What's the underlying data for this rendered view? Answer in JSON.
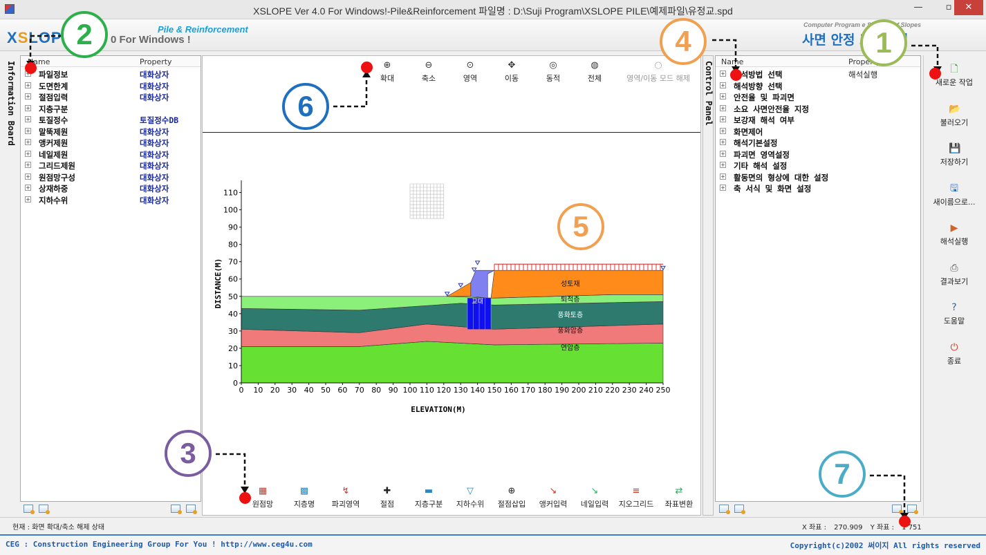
{
  "window": {
    "title": "XSLOPE Ver 4.0 For Windows!-Pile&Reinforcement  파일명 : D:\\Suji Program\\XSLOPE PILE\\예제파일\\유정교.spd",
    "min_label": "—",
    "max_label": "▫",
    "close_label": "✕"
  },
  "header": {
    "logo_x": "X",
    "logo_s": "S",
    "logo_rest": "LOP",
    "logo_sub": "0 For Windows !",
    "tagline": "Pile & Reinforcement",
    "brand_en": "Computer Program      e Stability of Slopes",
    "brand_ko": "사면 안정        프로그램"
  },
  "info_board": {
    "label": "Information Board",
    "col_name": "Name",
    "col_property": "Property",
    "items": [
      {
        "name": "파일정보",
        "property": "대화상자"
      },
      {
        "name": "도면한계",
        "property": "대화상자"
      },
      {
        "name": "절점입력",
        "property": "대화상자"
      },
      {
        "name": "지층구분",
        "property": ""
      },
      {
        "name": "토질정수",
        "property": "토질정수DB"
      },
      {
        "name": "말뚝제원",
        "property": "대화상자"
      },
      {
        "name": "앵커제원",
        "property": "대화상자"
      },
      {
        "name": "네일제원",
        "property": "대화상자"
      },
      {
        "name": "그리드제원",
        "property": "대화상자"
      },
      {
        "name": "원점망구성",
        "property": "대화상자"
      },
      {
        "name": "상재하중",
        "property": "대화상자"
      },
      {
        "name": "지하수위",
        "property": "대화상자"
      }
    ]
  },
  "control_panel": {
    "label": "Control Panel",
    "col_name": "Name",
    "col_property": "Property",
    "items": [
      {
        "name": "해석방법 선택",
        "property": "해석실행"
      },
      {
        "name": "해석방향 선택",
        "property": ""
      },
      {
        "name": "안전율 및 파괴면",
        "property": ""
      },
      {
        "name": "소요 사면안전율 지정",
        "property": ""
      },
      {
        "name": "보강재 해석 여부",
        "property": ""
      },
      {
        "name": "화면제어",
        "property": ""
      },
      {
        "name": "해석기본설정",
        "property": ""
      },
      {
        "name": "파괴면 영역설정",
        "property": ""
      },
      {
        "name": "기타 해석 설정",
        "property": ""
      },
      {
        "name": "활동면의 형상에 대한 설정",
        "property": ""
      },
      {
        "name": "축 서식 및 화면 설정",
        "property": ""
      }
    ]
  },
  "top_toolbar": [
    {
      "label": "확대",
      "icon": "zoom-in-icon",
      "glyph": "⊕"
    },
    {
      "label": "축소",
      "icon": "zoom-out-icon",
      "glyph": "⊖"
    },
    {
      "label": "영역",
      "icon": "zoom-area-icon",
      "glyph": "⊙"
    },
    {
      "label": "이동",
      "icon": "pan-icon",
      "glyph": "✥"
    },
    {
      "label": "동적",
      "icon": "dynamic-zoom-icon",
      "glyph": "◎"
    },
    {
      "label": "전체",
      "icon": "zoom-all-icon",
      "glyph": "◍"
    },
    {
      "label": "영역/이동 모드 해제",
      "icon": "release-mode-icon",
      "glyph": "○"
    }
  ],
  "bottom_toolbar": [
    {
      "label": "원점망",
      "icon": "origin-grid-icon",
      "glyph": "▦",
      "color": "#c0392b"
    },
    {
      "label": "지층명",
      "icon": "layer-name-icon",
      "glyph": "▩",
      "color": "#2e86c1"
    },
    {
      "label": "파괴영역",
      "icon": "failure-zone-icon",
      "glyph": "↯",
      "color": "#c0392b"
    },
    {
      "label": "절점",
      "icon": "node-icon",
      "glyph": "✚",
      "color": "#222222"
    },
    {
      "label": "지층구분",
      "icon": "layer-divide-icon",
      "glyph": "▬",
      "color": "#2e86c1"
    },
    {
      "label": "지하수위",
      "icon": "water-table-icon",
      "glyph": "▽",
      "color": "#2e86c1"
    },
    {
      "label": "절점삽입",
      "icon": "insert-node-icon",
      "glyph": "⊕",
      "color": "#222222"
    },
    {
      "label": "앵커입력",
      "icon": "anchor-input-icon",
      "glyph": "↘",
      "color": "#c0392b"
    },
    {
      "label": "네일입력",
      "icon": "nail-input-icon",
      "glyph": "↘",
      "color": "#27ae60"
    },
    {
      "label": "지오그리드",
      "icon": "geogrid-icon",
      "glyph": "≡",
      "color": "#c0392b"
    },
    {
      "label": "좌표변환",
      "icon": "coord-transform-icon",
      "glyph": "⇄",
      "color": "#27ae60"
    }
  ],
  "side_menu": [
    {
      "label": "새로운 작업",
      "icon": "new-file-icon",
      "glyph": "🗋"
    },
    {
      "label": "불러오기",
      "icon": "open-folder-icon",
      "glyph": "📂"
    },
    {
      "label": "저장하기",
      "icon": "save-icon",
      "glyph": "💾"
    },
    {
      "label": "새이름으로...",
      "icon": "save-as-icon",
      "glyph": "🖫"
    },
    {
      "label": "해석실행",
      "icon": "run-analysis-icon",
      "glyph": "▶"
    },
    {
      "label": "결과보기",
      "icon": "printer-icon",
      "glyph": "⎙"
    },
    {
      "label": "도움말",
      "icon": "help-icon",
      "glyph": "?"
    },
    {
      "label": "종료",
      "icon": "exit-icon",
      "glyph": "⏻"
    }
  ],
  "chart_data": {
    "type": "area",
    "xlabel": "ELEVATION(M)",
    "ylabel": "DISTANCE(M)",
    "xlim": [
      0,
      250
    ],
    "ylim": [
      0,
      115
    ],
    "xticks": [
      0,
      10,
      20,
      30,
      40,
      50,
      60,
      70,
      80,
      90,
      100,
      110,
      120,
      130,
      140,
      150,
      160,
      170,
      180,
      190,
      200,
      210,
      220,
      230,
      240,
      250
    ],
    "yticks": [
      0,
      10,
      20,
      30,
      40,
      50,
      60,
      70,
      80,
      90,
      100,
      110
    ],
    "layers": [
      {
        "name": "연암층",
        "color": "#66e033",
        "top": [
          [
            0,
            21
          ],
          [
            70,
            21
          ],
          [
            110,
            24
          ],
          [
            150,
            22
          ],
          [
            250,
            23
          ]
        ],
        "bottom": [
          [
            0,
            0
          ],
          [
            250,
            0
          ]
        ],
        "label_at": [
          195,
          19
        ]
      },
      {
        "name": "풍화암층",
        "color": "#f07a7a",
        "top": [
          [
            0,
            31
          ],
          [
            70,
            29
          ],
          [
            110,
            34
          ],
          [
            150,
            31
          ],
          [
            250,
            34
          ]
        ],
        "bottom": [
          [
            0,
            21
          ],
          [
            70,
            21
          ],
          [
            110,
            24
          ],
          [
            150,
            22
          ],
          [
            250,
            23
          ]
        ],
        "label_at": [
          195,
          29
        ]
      },
      {
        "name": "풍화토층",
        "color": "#2f7a6e",
        "top": [
          [
            0,
            43
          ],
          [
            70,
            42
          ],
          [
            130,
            46
          ],
          [
            150,
            45
          ],
          [
            250,
            47
          ]
        ],
        "bottom": [
          [
            0,
            31
          ],
          [
            70,
            29
          ],
          [
            110,
            34
          ],
          [
            150,
            31
          ],
          [
            250,
            34
          ]
        ],
        "label_at": [
          195,
          38
        ]
      },
      {
        "name": "퇴적층",
        "color": "#8af07a",
        "top": [
          [
            0,
            50
          ],
          [
            122,
            50
          ],
          [
            150,
            49
          ],
          [
            220,
            51
          ],
          [
            250,
            51
          ]
        ],
        "bottom": [
          [
            0,
            43
          ],
          [
            70,
            42
          ],
          [
            130,
            46
          ],
          [
            150,
            45
          ],
          [
            250,
            47
          ]
        ],
        "label_at": [
          195,
          47
        ]
      },
      {
        "name": "성토재",
        "color": "#ff8c1a",
        "top": [
          [
            150,
            65
          ],
          [
            250,
            65
          ]
        ],
        "bottom": [
          [
            148,
            49
          ],
          [
            220,
            51
          ],
          [
            250,
            51
          ]
        ],
        "label_at": [
          195,
          56
        ]
      }
    ],
    "embankment_left": {
      "color": "#ff8c1a",
      "points": [
        [
          122,
          50
        ],
        [
          136,
          58
        ],
        [
          136,
          50
        ]
      ]
    },
    "abutment": {
      "name": "교대",
      "color": "#8080f0",
      "points": [
        [
          136,
          50
        ],
        [
          136,
          58
        ],
        [
          139,
          65
        ],
        [
          150,
          65
        ],
        [
          146,
          63
        ],
        [
          146,
          49
        ]
      ]
    },
    "piles": {
      "color": "#1010ee",
      "x": [
        134,
        148
      ],
      "y": [
        31,
        49
      ]
    },
    "surcharge": {
      "color": "#e03030",
      "x": [
        150,
        250
      ],
      "y": [
        65,
        67
      ]
    },
    "groundwater_marks": [
      [
        122,
        50
      ],
      [
        130,
        55
      ],
      [
        138,
        64
      ],
      [
        140,
        68
      ],
      [
        250,
        65
      ]
    ],
    "grid_box": {
      "x": [
        100,
        120
      ],
      "y": [
        95,
        115
      ]
    }
  },
  "status": {
    "left": "현재 : 화면 확대/축소 해제 상태",
    "x_label": "X 좌표 :",
    "x_value": "270.909",
    "y_label": "Y 좌표 :",
    "y_value": "1   751"
  },
  "footer": {
    "left": "CEG : Construction Engineering Group For You ! http://www.ceg4u.com",
    "right": "Copyright(c)2002 써이지 All rights reserved"
  },
  "annotations": [
    {
      "num": "1",
      "color": "#9bbb59"
    },
    {
      "num": "2",
      "color": "#2db04b"
    },
    {
      "num": "3",
      "color": "#7a5ca0"
    },
    {
      "num": "4",
      "color": "#f0a050"
    },
    {
      "num": "5",
      "color": "#f0a050"
    },
    {
      "num": "6",
      "color": "#1f6fbf"
    },
    {
      "num": "7",
      "color": "#4aacc6"
    }
  ]
}
